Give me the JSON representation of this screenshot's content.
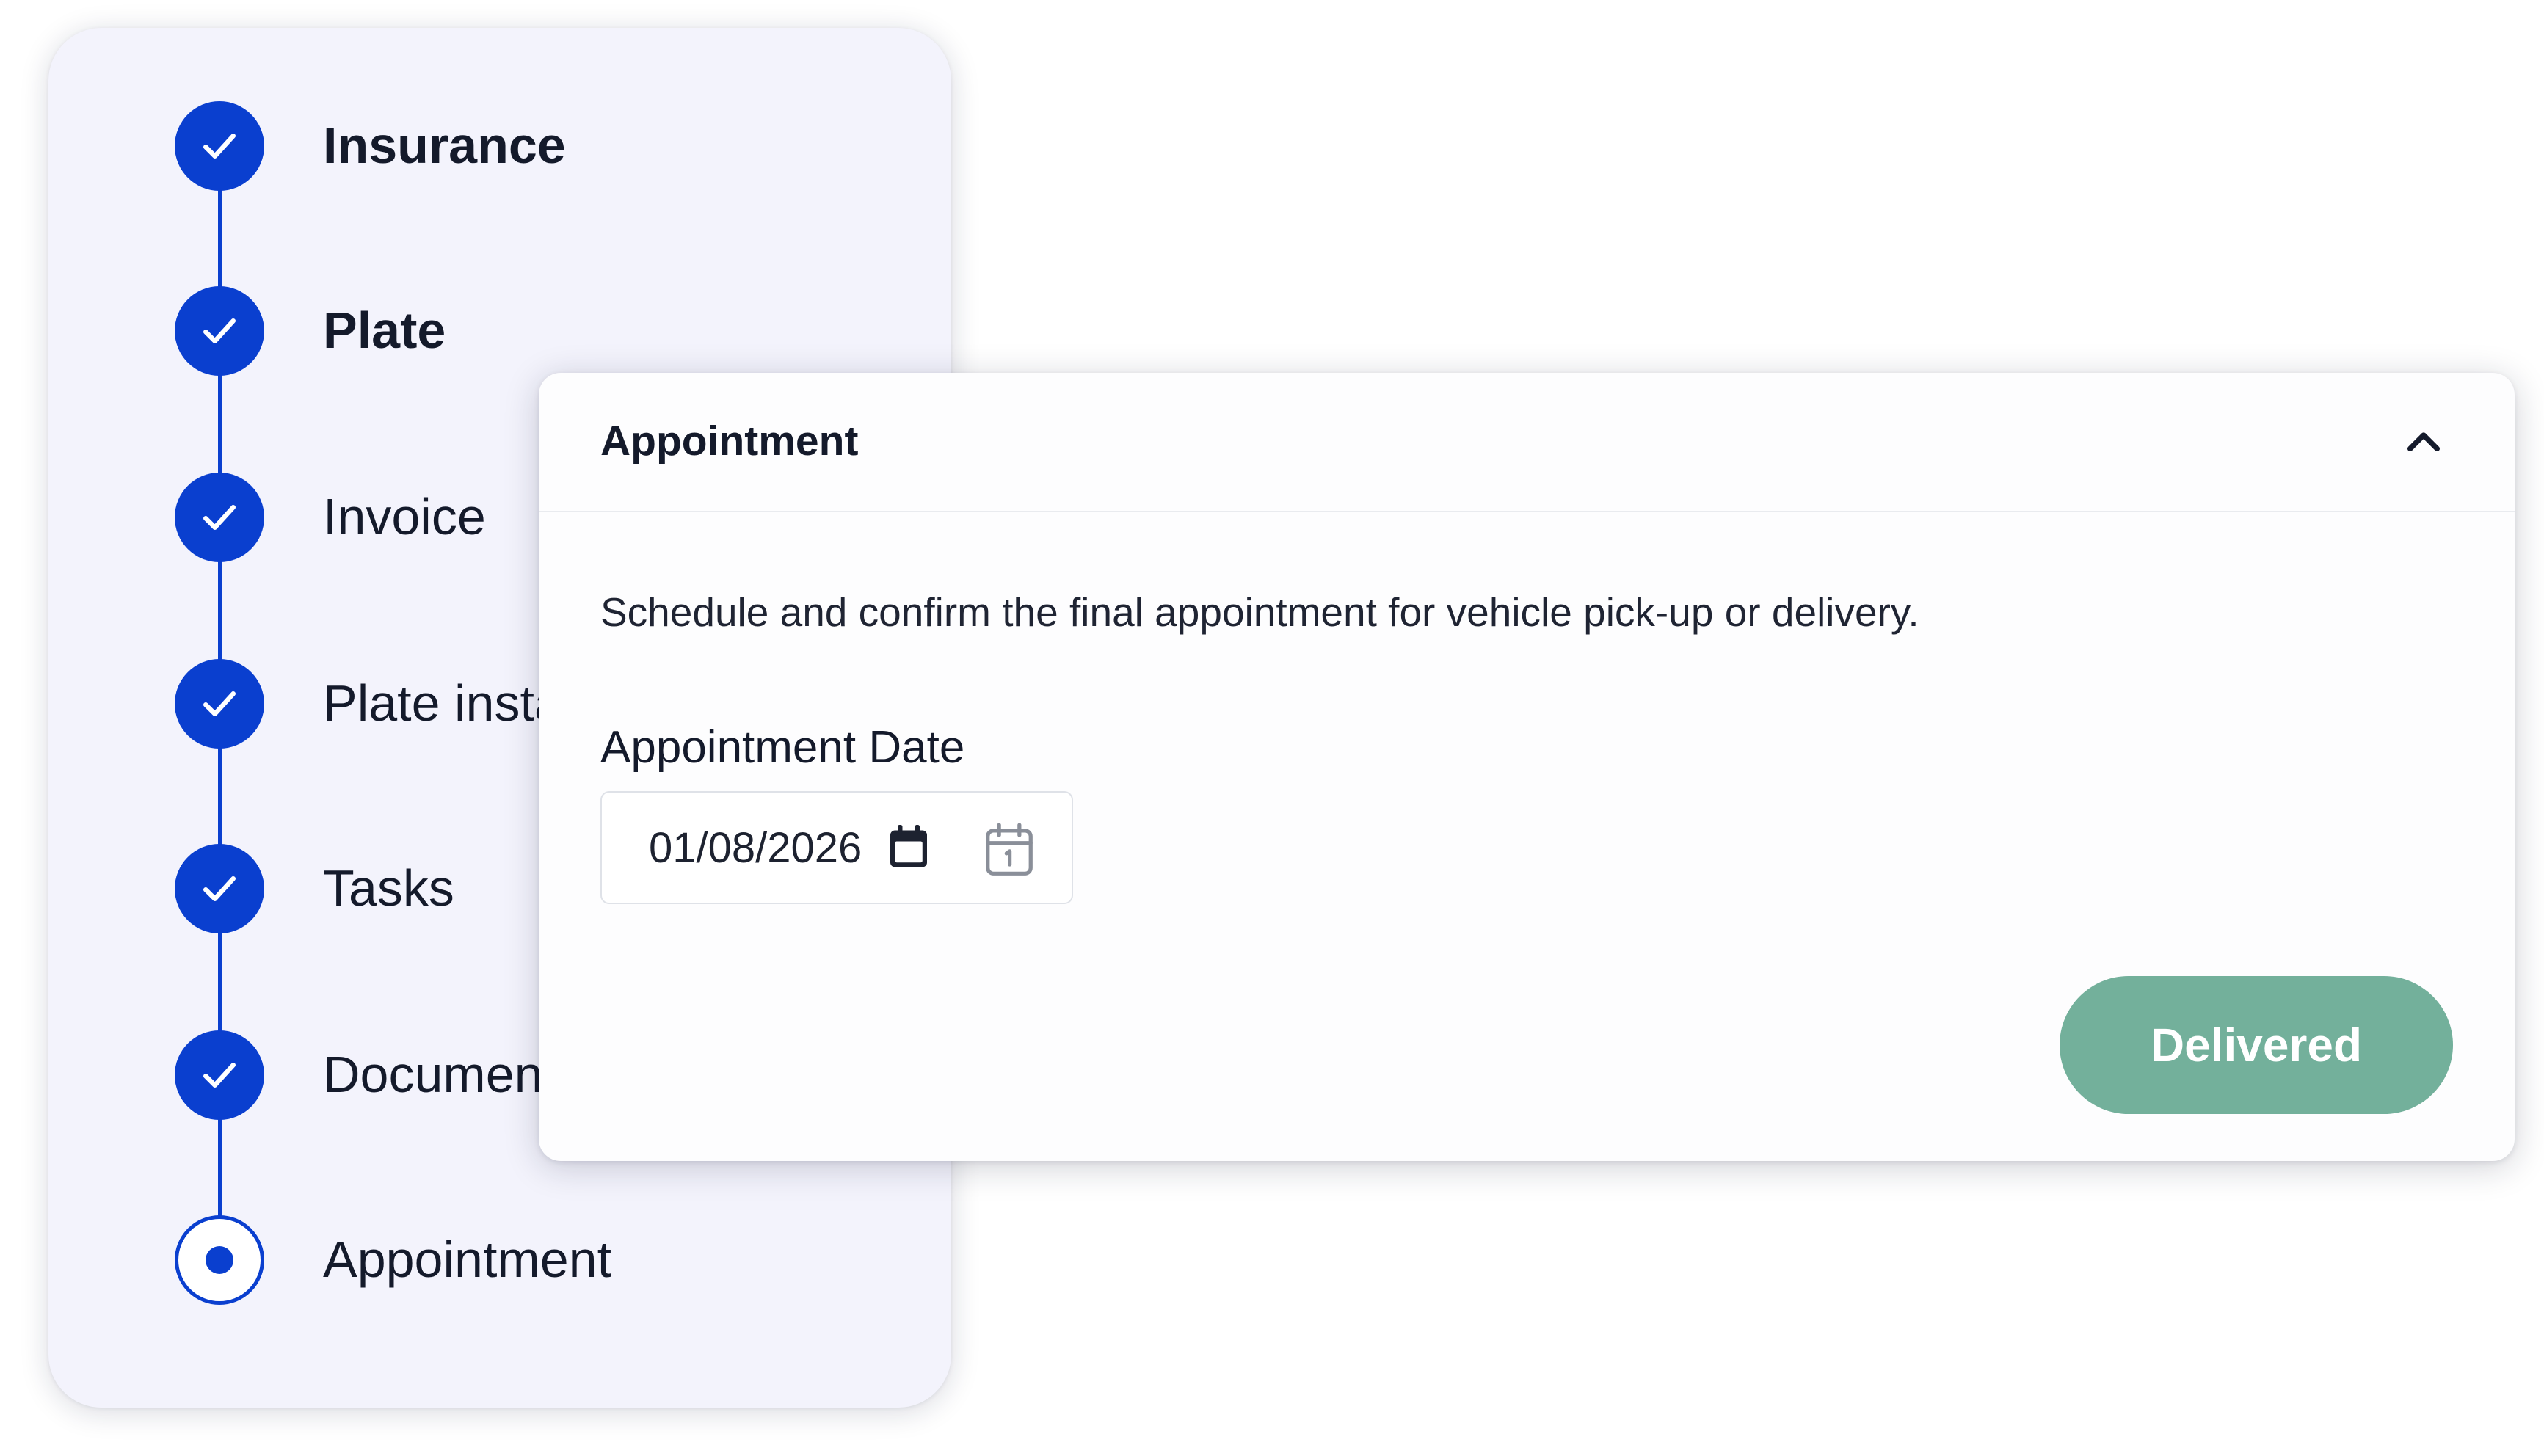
{
  "stepper": {
    "steps": [
      {
        "label": "Insurance",
        "status": "completed"
      },
      {
        "label": "Plate",
        "status": "completed"
      },
      {
        "label": "Invoice",
        "status": "completed"
      },
      {
        "label": "Plate installation",
        "status": "completed"
      },
      {
        "label": "Tasks",
        "status": "completed"
      },
      {
        "label": "Documents",
        "status": "completed"
      },
      {
        "label": "Appointment",
        "status": "current"
      }
    ],
    "icons": {
      "completed": "check-icon",
      "current": "radio-dot-icon"
    }
  },
  "panel": {
    "title": "Appointment",
    "expanded": true,
    "toggle_icon": "chevron-up-icon",
    "description": "Schedule and confirm the final appointment for vehicle pick-up or delivery.",
    "date_field": {
      "label": "Appointment Date",
      "value": "01/08/2026",
      "native_picker_icon": "calendar-filled-icon",
      "picker_icon": "calendar-icon"
    },
    "button_label": "Delivered"
  },
  "colors": {
    "step_accent": "#0a3fcf",
    "stepper_background": "#f3f3fc",
    "button_background": "#73b09b",
    "button_text": "#ffffff",
    "text_primary": "#141a2b"
  }
}
